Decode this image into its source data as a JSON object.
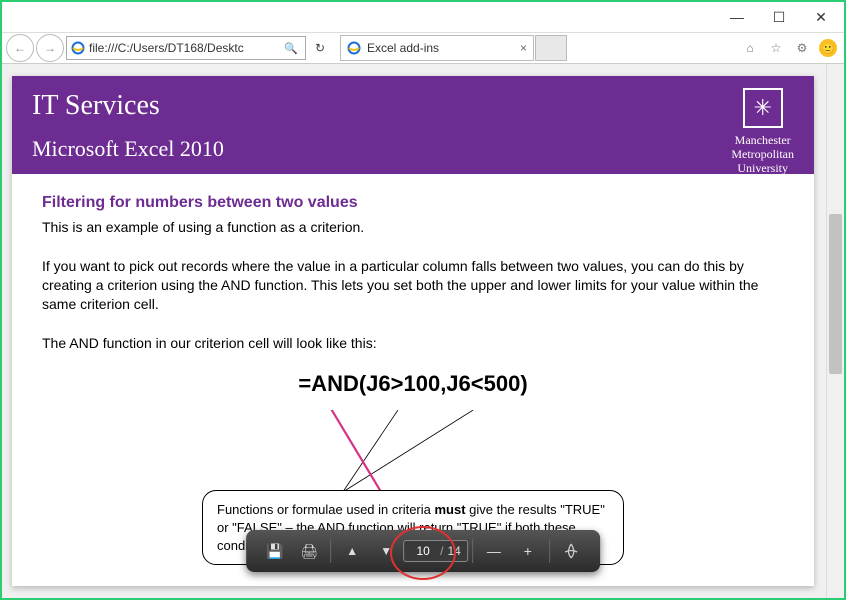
{
  "window": {
    "minimize": "—",
    "maximize": "☐",
    "close": "✕"
  },
  "browser": {
    "url": "file:///C:/Users/DT168/Desktc",
    "tab_title": "Excel add-ins",
    "back_icon": "←",
    "forward_icon": "→",
    "search_icon": "🔍",
    "refresh_icon": "↻",
    "tab_close": "×",
    "home_icon": "⌂",
    "fav_icon": "☆",
    "gear_icon": "⚙",
    "smiley": "🙂"
  },
  "banner": {
    "title": "IT Services",
    "subtitle": "Microsoft Excel 2010",
    "logo_mark": "✳",
    "logo_line1": "Manchester",
    "logo_line2": "Metropolitan",
    "logo_line3": "University"
  },
  "content": {
    "section_title": "Filtering for numbers between two values",
    "p1": "This is an example of using a function as a criterion.",
    "p2": "If you want to pick out records where the value in a particular column falls between two values, you can do this by creating a criterion using the AND function.  This lets you set both the upper and lower limits for your value within the same criterion cell.",
    "p3": "The AND function in our criterion cell will look like this:",
    "formula": "=AND(J6>100,J6<500)",
    "callout_a": "Functions or formulae used in criteria ",
    "callout_must": "must",
    "callout_a2": " give the results \"TRUE\" or \"FALSE\" – the AND function will return \"TRUE\" if both these conditions are met and \"FALSE\" if they are not"
  },
  "pdf": {
    "save_icon": "💾",
    "print_icon": "🖨",
    "up_icon": "▲",
    "down_icon": "▼",
    "current_page": "10",
    "sep": "/",
    "total_pages": "14",
    "zoom_out": "—",
    "zoom_in": "+",
    "acrobat_icon": "A"
  }
}
